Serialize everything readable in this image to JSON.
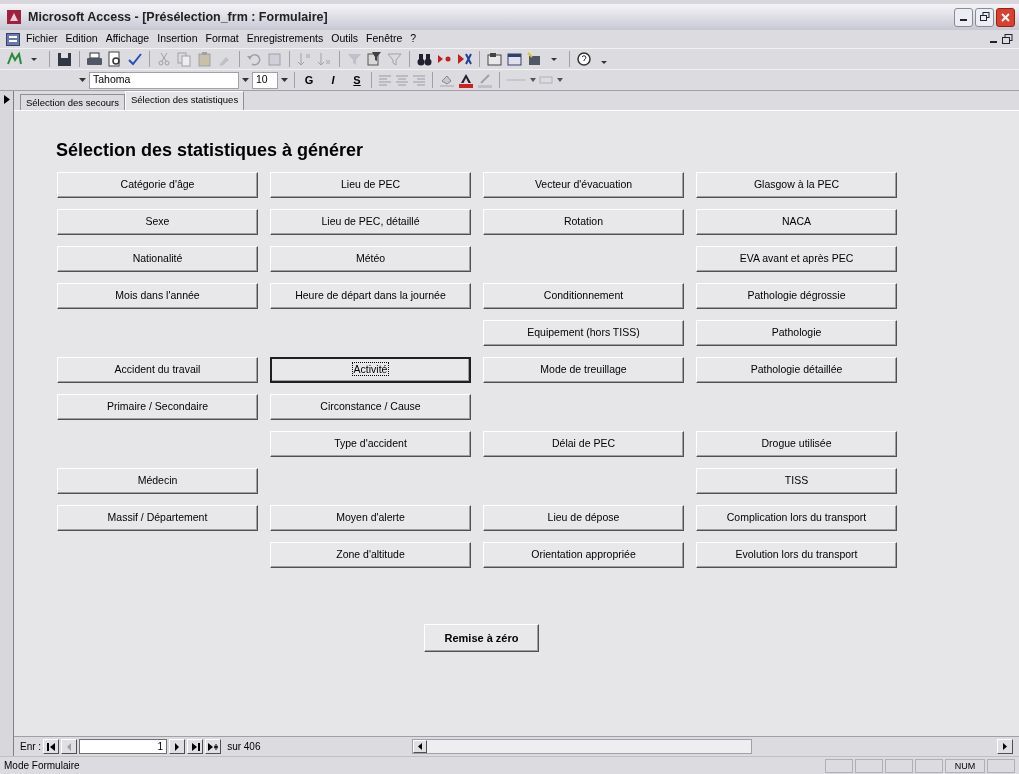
{
  "window": {
    "title": "Microsoft Access - [Présélection_frm : Formulaire]"
  },
  "menu": [
    "Fichier",
    "Edition",
    "Affichage",
    "Insertion",
    "Format",
    "Enregistrements",
    "Outils",
    "Fenêtre",
    "?"
  ],
  "font_toolbar": {
    "font": "Tahoma",
    "size": "10",
    "format_buttons": [
      "G",
      "I",
      "S"
    ]
  },
  "tabs": [
    {
      "label": "Sélection des secours",
      "selected": false
    },
    {
      "label": "Sélection des statistiques",
      "selected": true
    }
  ],
  "form": {
    "heading": "Sélection des statistiques à générer",
    "rows": [
      [
        {
          "kind": "button",
          "label": "Catégorie d'âge",
          "focused": false
        },
        {
          "kind": "button",
          "label": "Lieu de PEC",
          "focused": false
        },
        {
          "kind": "button",
          "label": "Vecteur d'évacuation",
          "focused": false
        },
        {
          "kind": "button",
          "label": "Glasgow à la PEC",
          "focused": false
        }
      ],
      [
        {
          "kind": "button",
          "label": "Sexe",
          "focused": false
        },
        {
          "kind": "button",
          "label": "Lieu de PEC, détaillé",
          "focused": false
        },
        {
          "kind": "button",
          "label": "Rotation",
          "focused": false
        },
        {
          "kind": "button",
          "label": "NACA",
          "focused": false
        }
      ],
      [
        {
          "kind": "button",
          "label": "Nationalité",
          "focused": false
        },
        {
          "kind": "button",
          "label": "Météo",
          "focused": false
        },
        {
          "kind": "empty"
        },
        {
          "kind": "button",
          "label": "EVA avant et après PEC",
          "focused": false
        }
      ],
      [
        {
          "kind": "button",
          "label": "Mois dans l'année",
          "focused": false
        },
        {
          "kind": "button",
          "label": "Heure de départ dans la journée",
          "focused": false
        },
        {
          "kind": "button",
          "label": "Conditionnement",
          "focused": false
        },
        {
          "kind": "button",
          "label": "Pathologie dégrossie",
          "focused": false
        }
      ],
      [
        {
          "kind": "empty"
        },
        {
          "kind": "empty"
        },
        {
          "kind": "button",
          "label": "Equipement (hors TISS)",
          "focused": false
        },
        {
          "kind": "button",
          "label": "Pathologie",
          "focused": false
        }
      ],
      [
        {
          "kind": "button",
          "label": "Accident du travail",
          "focused": false
        },
        {
          "kind": "button",
          "label": "Activité",
          "focused": true
        },
        {
          "kind": "button",
          "label": "Mode de treuillage",
          "focused": false
        },
        {
          "kind": "button",
          "label": "Pathologie détaillée",
          "focused": false
        }
      ],
      [
        {
          "kind": "button",
          "label": "Primaire / Secondaire",
          "focused": false
        },
        {
          "kind": "button",
          "label": "Circonstance / Cause",
          "focused": false
        },
        {
          "kind": "empty"
        },
        {
          "kind": "empty"
        }
      ],
      [
        {
          "kind": "empty"
        },
        {
          "kind": "button",
          "label": "Type d'accident",
          "focused": false
        },
        {
          "kind": "button",
          "label": "Délai de PEC",
          "focused": false
        },
        {
          "kind": "button",
          "label": "Drogue utilisée",
          "focused": false
        }
      ],
      [
        {
          "kind": "button",
          "label": "Médecin",
          "focused": false
        },
        {
          "kind": "empty"
        },
        {
          "kind": "empty"
        },
        {
          "kind": "button",
          "label": "TISS",
          "focused": false
        }
      ],
      [
        {
          "kind": "button",
          "label": "Massif / Département",
          "focused": false
        },
        {
          "kind": "button",
          "label": "Moyen d'alerte",
          "focused": false
        },
        {
          "kind": "button",
          "label": "Lieu de dépose",
          "focused": false
        },
        {
          "kind": "button",
          "label": "Complication lors du transport",
          "focused": false
        }
      ],
      [
        {
          "kind": "empty"
        },
        {
          "kind": "button",
          "label": "Zone d'altitude",
          "focused": false
        },
        {
          "kind": "button",
          "label": "Orientation appropriée",
          "focused": false
        },
        {
          "kind": "button",
          "label": "Evolution lors du transport",
          "focused": false
        }
      ]
    ],
    "reset_button": "Remise à zéro"
  },
  "record_navigator": {
    "label": "Enr :",
    "current": "1",
    "total": "sur 406"
  },
  "status_bar": {
    "mode": "Mode Formulaire",
    "indicator": "NUM"
  }
}
